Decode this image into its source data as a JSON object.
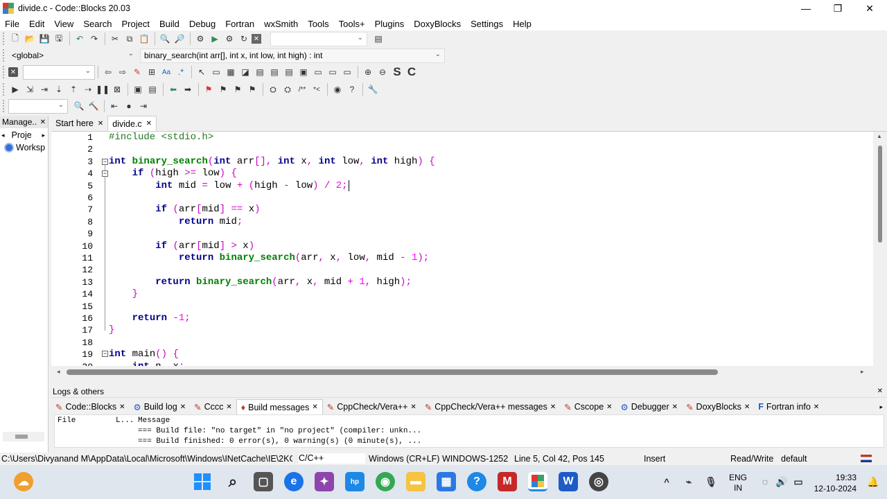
{
  "window": {
    "title": "divide.c - Code::Blocks 20.03",
    "minimize": "—",
    "maximize": "❐",
    "close": "✕"
  },
  "menu": [
    "File",
    "Edit",
    "View",
    "Search",
    "Project",
    "Build",
    "Debug",
    "Fortran",
    "wxSmith",
    "Tools",
    "Tools+",
    "Plugins",
    "DoxyBlocks",
    "Settings",
    "Help"
  ],
  "scope": {
    "global": "<global>",
    "function": "binary_search(int arr[], int x, int low, int high) : int"
  },
  "side": {
    "title": "Manage..",
    "close": "✕",
    "projects_tab": "Proje",
    "workspace": "Worksp"
  },
  "tabs": [
    {
      "label": "Start here",
      "close": "✕"
    },
    {
      "label": "divide.c",
      "close": "✕"
    }
  ],
  "code": {
    "lines": [
      "1",
      "2",
      "3",
      "4",
      "5",
      "6",
      "7",
      "8",
      "9",
      "10",
      "11",
      "12",
      "13",
      "14",
      "15",
      "16",
      "17",
      "18",
      "19",
      "20"
    ]
  },
  "logs": {
    "title": "Logs & others",
    "close": "✕",
    "tabs": [
      "Code::Blocks",
      "Build log",
      "Cccc",
      "Build messages",
      "CppCheck/Vera++",
      "CppCheck/Vera++ messages",
      "Cscope",
      "Debugger",
      "DoxyBlocks",
      "Fortran info"
    ],
    "columns": [
      "File",
      "L...",
      "Message"
    ],
    "rows": [
      "=== Build file: \"no target\" in \"no project\" (compiler: unkn...",
      "=== Build finished: 0 error(s), 0 warning(s) (0 minute(s), ..."
    ]
  },
  "status": {
    "path": "C:\\Users\\Divyanand M\\AppData\\Local\\Microsoft\\Windows\\INetCache\\IE\\2KO...",
    "lang": "C/C++",
    "eol": "Windows (CR+LF)",
    "encoding": "WINDOWS-1252",
    "position": "Line 5, Col 42, Pos 145",
    "mode": "Insert",
    "access": "Read/Write",
    "profile": "default"
  },
  "taskbar": {
    "lang1": "ENG",
    "lang2": "IN",
    "time": "19:33",
    "date": "12-10-2024"
  }
}
